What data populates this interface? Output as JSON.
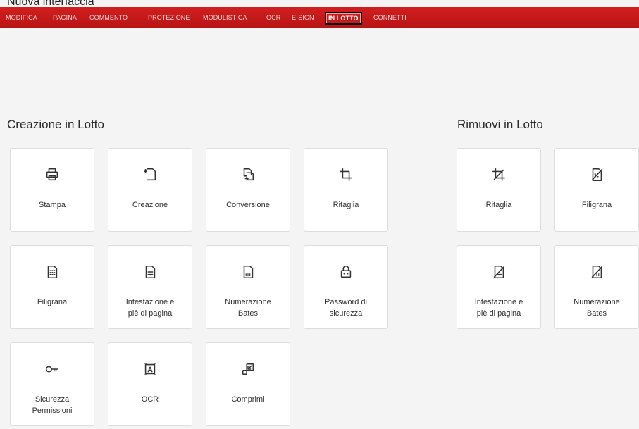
{
  "caption": "Nuova interfaccia",
  "menu": {
    "items": [
      {
        "label": "MODIFICA",
        "active": false
      },
      {
        "label": "PAGINA",
        "active": false
      },
      {
        "label": "COMMENTO",
        "active": false
      },
      {
        "label": "PROTEZIONE",
        "active": false
      },
      {
        "label": "MODULISTICA",
        "active": false
      },
      {
        "label": "OCR",
        "active": false
      },
      {
        "label": "E-SIGN",
        "active": false
      },
      {
        "label": "IN LOTTO",
        "active": true
      },
      {
        "label": "CONNETTI",
        "active": false
      }
    ]
  },
  "creation": {
    "title": "Creazione in Lotto",
    "cards": [
      {
        "label": "Stampa",
        "icon": "printer-icon"
      },
      {
        "label": "Creazione",
        "icon": "create-icon"
      },
      {
        "label": "Conversione",
        "icon": "convert-icon"
      },
      {
        "label": "Ritaglia",
        "icon": "crop-icon"
      },
      {
        "label": "Filigrana",
        "icon": "watermark-icon"
      },
      {
        "label": "Intestazione e\npiè di pagina",
        "icon": "header-footer-icon"
      },
      {
        "label": "Numerazione\nBates",
        "icon": "bates-icon"
      },
      {
        "label": "Password di\nsicurezza",
        "icon": "lock-icon"
      },
      {
        "label": "Sicurezza\nPermissioni",
        "icon": "key-icon"
      },
      {
        "label": "OCR",
        "icon": "ocr-icon"
      },
      {
        "label": "Comprimi",
        "icon": "compress-icon"
      }
    ]
  },
  "remove": {
    "title": "Rimuovi in Lotto",
    "cards": [
      {
        "label": "Ritaglia",
        "icon": "remove-crop-icon"
      },
      {
        "label": "Filigrana",
        "icon": "remove-watermark-icon"
      },
      {
        "label": "Intestazione e\npiè di pagina",
        "icon": "remove-header-footer-icon"
      },
      {
        "label": "Numerazione\nBates",
        "icon": "remove-bates-icon"
      }
    ]
  },
  "colors": {
    "toolbar": "#c41b1b",
    "background": "#f4f4f4",
    "card": "#ffffff"
  }
}
